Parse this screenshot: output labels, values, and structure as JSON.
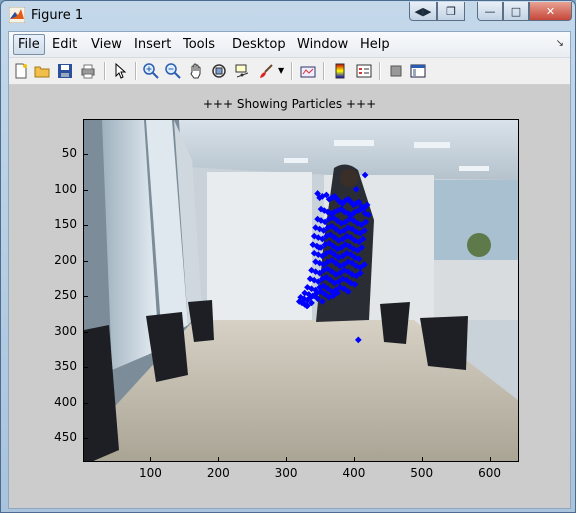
{
  "window": {
    "title": "Figure 1"
  },
  "menu": {
    "items": [
      {
        "label": "File",
        "name": "menu-file"
      },
      {
        "label": "Edit",
        "name": "menu-edit"
      },
      {
        "label": "View",
        "name": "menu-view"
      },
      {
        "label": "Insert",
        "name": "menu-insert"
      },
      {
        "label": "Tools",
        "name": "menu-tools"
      },
      {
        "label": "Desktop",
        "name": "menu-desktop"
      },
      {
        "label": "Window",
        "name": "menu-window"
      },
      {
        "label": "Help",
        "name": "menu-help"
      }
    ]
  },
  "toolbar": {
    "icons": [
      "new-figure-icon",
      "open-file-icon",
      "save-icon",
      "print-icon",
      "pointer-icon",
      "zoom-in-icon",
      "zoom-out-icon",
      "pan-icon",
      "rotate-3d-icon",
      "data-cursor-icon",
      "brush-icon",
      "link-plot-icon",
      "colorbar-icon",
      "legend-icon",
      "hide-plot-tools-icon",
      "show-plot-tools-icon"
    ]
  },
  "plot": {
    "title": "+++ Showing Particles +++",
    "yticks": [
      "50",
      "100",
      "150",
      "200",
      "250",
      "300",
      "350",
      "400",
      "450"
    ],
    "xticks": [
      "100",
      "200",
      "300",
      "400",
      "500",
      "600"
    ]
  },
  "chart_data": {
    "type": "scatter",
    "title": "+++ Showing Particles +++",
    "xlabel": "",
    "ylabel": "",
    "xlim": [
      0.5,
      640.5
    ],
    "ylim": [
      480.5,
      0.5
    ],
    "y_reversed": true,
    "yticks": [
      50,
      100,
      150,
      200,
      250,
      300,
      350,
      400,
      450
    ],
    "xticks": [
      100,
      200,
      300,
      400,
      500,
      600
    ],
    "marker_color": "#0000ff",
    "series": [
      {
        "x": [
          415,
          402,
          345,
          348,
          352,
          358,
          362,
          366,
          370,
          374,
          378,
          382,
          386,
          390,
          394,
          398,
          402,
          406,
          410,
          414,
          418,
          350,
          355,
          360,
          365,
          370,
          375,
          380,
          385,
          390,
          395,
          400,
          405,
          410,
          415,
          420,
          345,
          350,
          356,
          362,
          368,
          374,
          380,
          386,
          392,
          398,
          404,
          410,
          416,
          342,
          348,
          354,
          360,
          366,
          372,
          378,
          384,
          390,
          396,
          402,
          408,
          414,
          340,
          346,
          352,
          358,
          364,
          370,
          376,
          382,
          388,
          394,
          400,
          406,
          412,
          338,
          344,
          350,
          356,
          362,
          368,
          374,
          380,
          386,
          392,
          398,
          404,
          410,
          340,
          346,
          352,
          358,
          364,
          370,
          376,
          382,
          388,
          394,
          400,
          406,
          342,
          348,
          354,
          360,
          366,
          372,
          378,
          384,
          390,
          396,
          402,
          408,
          414,
          336,
          342,
          348,
          354,
          360,
          366,
          372,
          378,
          384,
          390,
          396,
          402,
          408,
          334,
          340,
          346,
          352,
          358,
          364,
          370,
          376,
          382,
          388,
          394,
          400,
          330,
          336,
          342,
          348,
          354,
          360,
          366,
          372,
          378,
          384,
          390,
          326,
          332,
          338,
          344,
          350,
          356,
          362,
          368,
          374,
          320,
          325,
          330,
          335,
          340,
          345,
          352,
          318,
          322,
          326,
          330,
          336,
          347,
          329,
          405
        ],
        "y": [
          78,
          98,
          104,
          110,
          108,
          106,
          112,
          110,
          108,
          112,
          116,
          118,
          114,
          112,
          116,
          120,
          118,
          116,
          122,
          124,
          120,
          126,
          128,
          130,
          132,
          130,
          128,
          126,
          130,
          132,
          134,
          130,
          128,
          126,
          132,
          134,
          140,
          142,
          144,
          140,
          138,
          142,
          146,
          144,
          140,
          142,
          146,
          148,
          144,
          152,
          154,
          156,
          152,
          150,
          154,
          158,
          156,
          152,
          154,
          158,
          160,
          156,
          164,
          166,
          168,
          164,
          162,
          166,
          170,
          168,
          164,
          166,
          170,
          172,
          168,
          176,
          178,
          180,
          176,
          174,
          178,
          182,
          180,
          176,
          178,
          182,
          184,
          180,
          188,
          190,
          192,
          188,
          186,
          190,
          194,
          192,
          188,
          190,
          194,
          196,
          200,
          202,
          204,
          200,
          198,
          202,
          206,
          204,
          200,
          202,
          206,
          208,
          204,
          212,
          214,
          216,
          212,
          210,
          214,
          218,
          216,
          212,
          214,
          218,
          220,
          216,
          224,
          226,
          228,
          224,
          222,
          226,
          230,
          228,
          224,
          226,
          230,
          232,
          236,
          238,
          240,
          236,
          234,
          238,
          242,
          240,
          236,
          238,
          242,
          244,
          246,
          248,
          244,
          242,
          246,
          250,
          248,
          244,
          250,
          252,
          254,
          250,
          248,
          252,
          256,
          256,
          258,
          260,
          262,
          258,
          180,
          262,
          310
        ]
      }
    ]
  }
}
